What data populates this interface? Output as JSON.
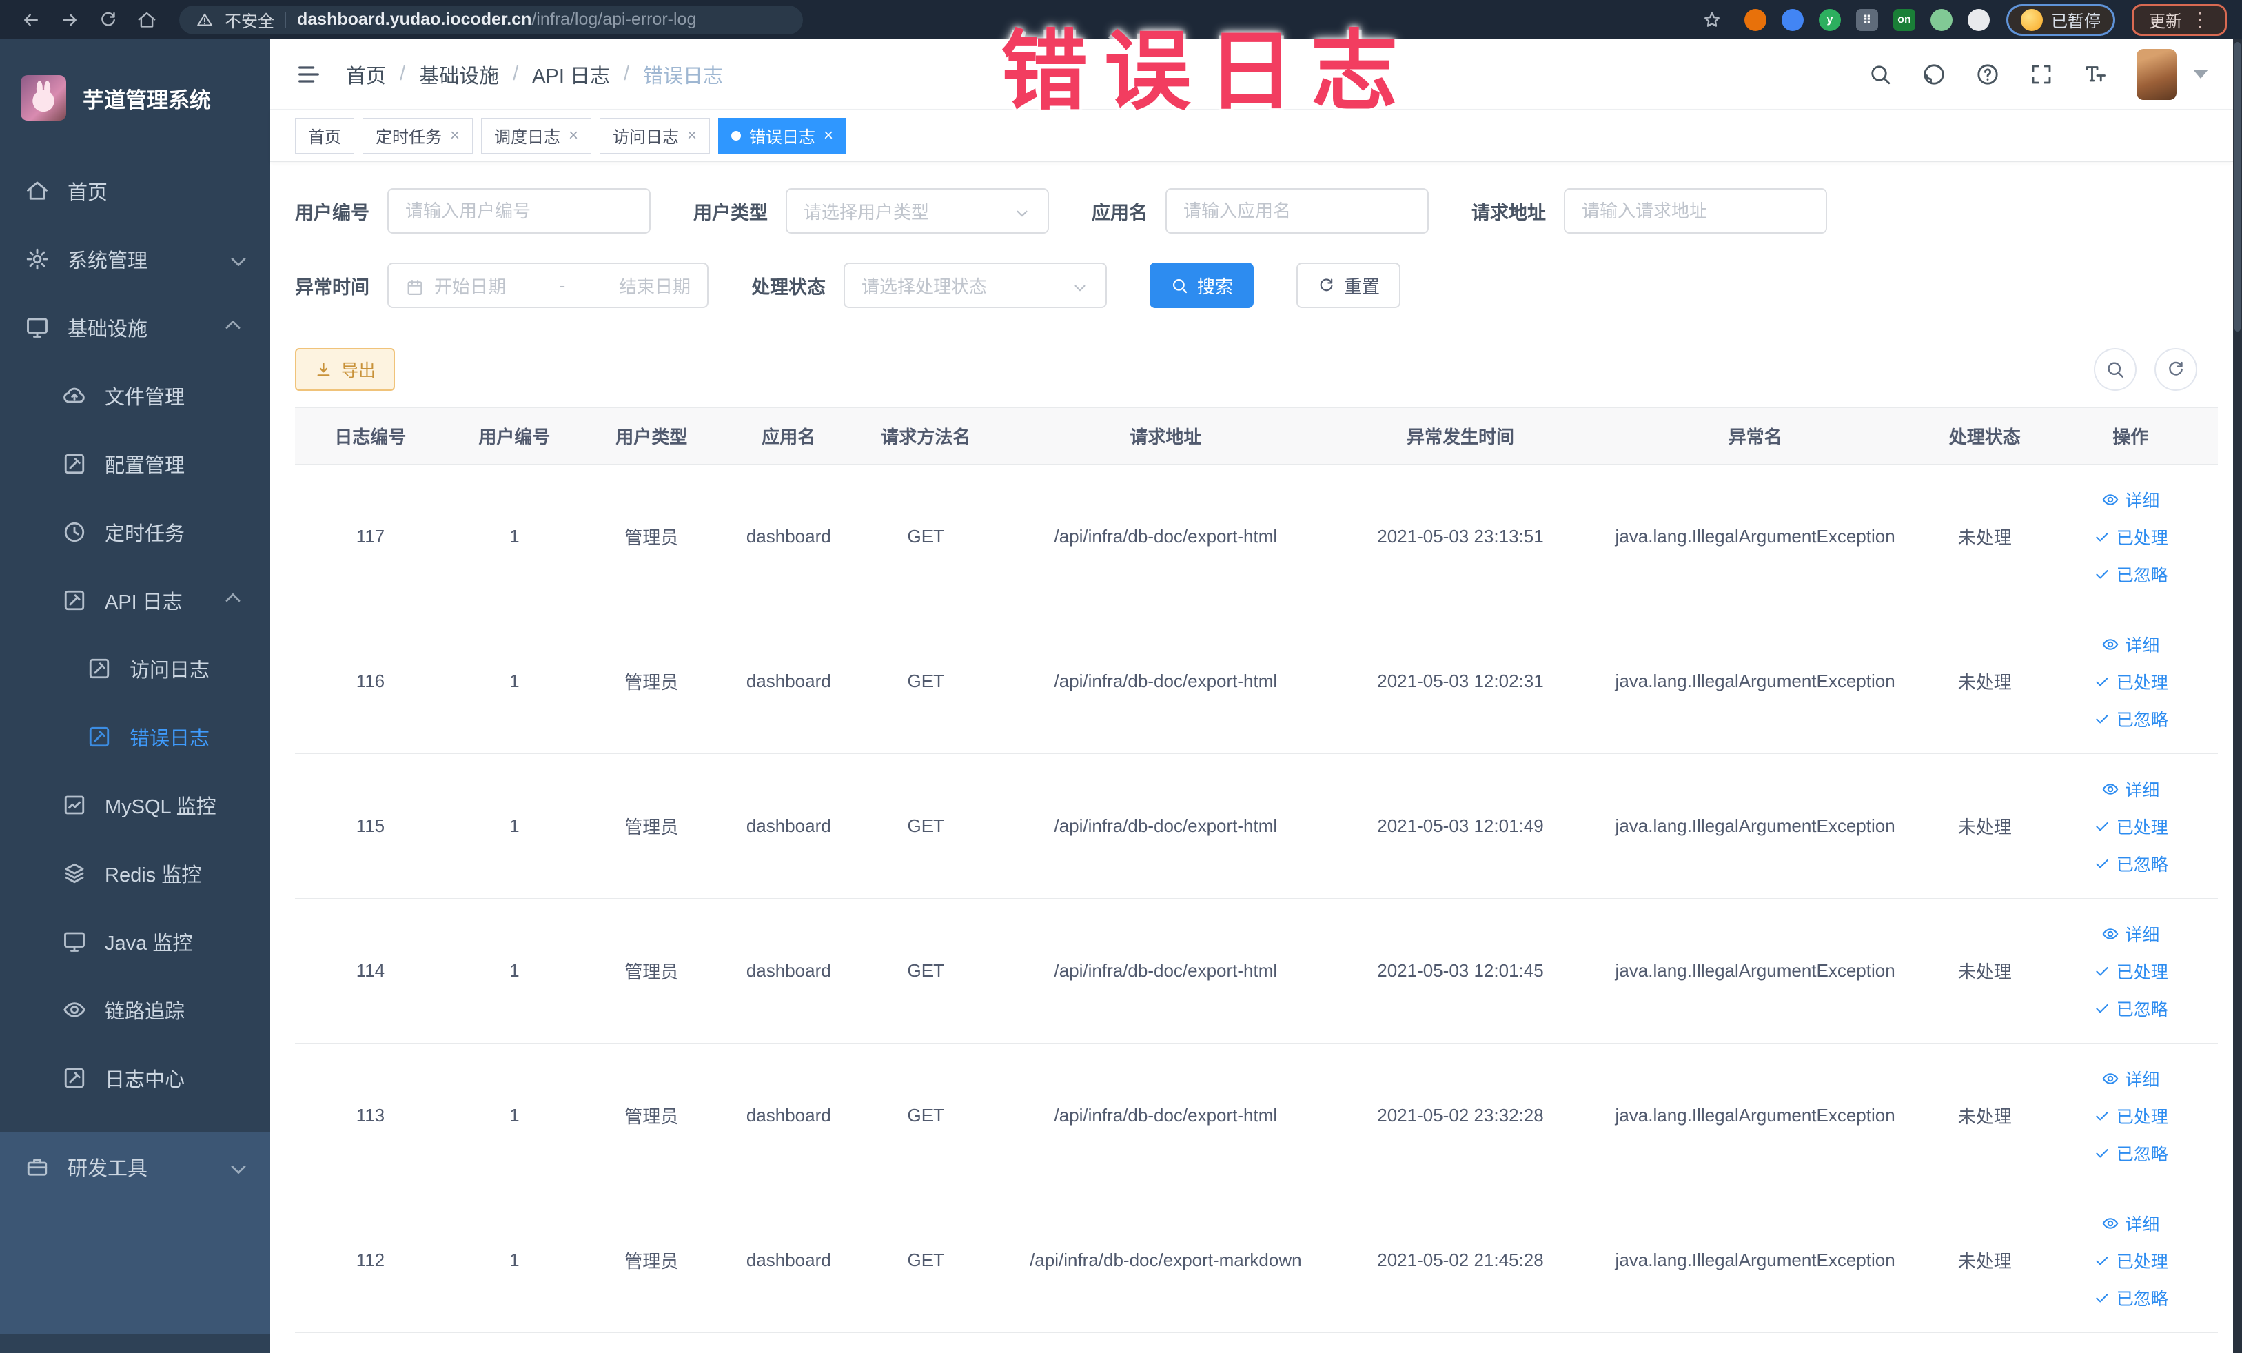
{
  "browser": {
    "security_label": "不安全",
    "url_host": "dashboard.yudao.iocoder.cn",
    "url_path": "/infra/log/api-error-log",
    "paused_badge": "已暂停",
    "update_badge": "更新",
    "extensions": [
      {
        "name": "ext-orange-circle",
        "color": "#e8710a",
        "shape": "circle"
      },
      {
        "name": "ext-blue-shield",
        "color": "#4285f4",
        "shape": "circle"
      },
      {
        "name": "ext-green-y",
        "color": "#2daf5f",
        "shape": "circle",
        "glyph": "y"
      },
      {
        "name": "ext-grid",
        "color": "#5f6b7a",
        "shape": "square",
        "glyph": "⠿"
      },
      {
        "name": "ext-on-toggle",
        "color": "#1a7f37",
        "shape": "square",
        "glyph": "on"
      },
      {
        "name": "ext-green-leaf",
        "color": "#81c995",
        "shape": "circle"
      },
      {
        "name": "ext-white-star",
        "color": "#e8eaed",
        "shape": "circle"
      }
    ]
  },
  "watermark": "错误日志",
  "sidebar": {
    "title": "芋道管理系统",
    "items": [
      {
        "icon": "home",
        "label": "首页",
        "level": 1
      },
      {
        "icon": "gear",
        "label": "系统管理",
        "level": 1,
        "chevron": "down"
      },
      {
        "icon": "monitor",
        "label": "基础设施",
        "level": 1,
        "chevron": "up"
      },
      {
        "icon": "cloud",
        "label": "文件管理",
        "level": 2
      },
      {
        "icon": "edit",
        "label": "配置管理",
        "level": 2
      },
      {
        "icon": "clock",
        "label": "定时任务",
        "level": 2
      },
      {
        "icon": "edit",
        "label": "API 日志",
        "level": 2,
        "chevron": "up"
      },
      {
        "icon": "edit",
        "label": "访问日志",
        "level": 3
      },
      {
        "icon": "edit",
        "label": "错误日志",
        "level": 3,
        "active": true
      },
      {
        "icon": "chart",
        "label": "MySQL 监控",
        "level": 2
      },
      {
        "icon": "layers",
        "label": "Redis 监控",
        "level": 2
      },
      {
        "icon": "monitor",
        "label": "Java 监控",
        "level": 2
      },
      {
        "icon": "eye",
        "label": "链路追踪",
        "level": 2
      },
      {
        "icon": "edit",
        "label": "日志中心",
        "level": 2
      }
    ],
    "bottom_item": {
      "icon": "tool",
      "label": "研发工具",
      "chevron": "down"
    }
  },
  "header": {
    "breadcrumb": [
      "首页",
      "基础设施",
      "API 日志",
      "错误日志"
    ]
  },
  "tabs": [
    {
      "label": "首页"
    },
    {
      "label": "定时任务",
      "closable": true
    },
    {
      "label": "调度日志",
      "closable": true
    },
    {
      "label": "访问日志",
      "closable": true
    },
    {
      "label": "错误日志",
      "closable": true,
      "active": true
    }
  ],
  "filters": {
    "user_id": {
      "label": "用户编号",
      "placeholder": "请输入用户编号"
    },
    "user_type": {
      "label": "用户类型",
      "placeholder": "请选择用户类型"
    },
    "app_name": {
      "label": "应用名",
      "placeholder": "请输入应用名"
    },
    "request_url": {
      "label": "请求地址",
      "placeholder": "请输入请求地址"
    },
    "exception_time": {
      "label": "异常时间",
      "start_placeholder": "开始日期",
      "separator": "-",
      "end_placeholder": "结束日期"
    },
    "process_status": {
      "label": "处理状态",
      "placeholder": "请选择处理状态"
    },
    "search_label": "搜索",
    "reset_label": "重置"
  },
  "toolbar": {
    "export_label": "导出"
  },
  "table": {
    "columns": [
      "日志编号",
      "用户编号",
      "用户类型",
      "应用名",
      "请求方法名",
      "请求地址",
      "异常发生时间",
      "异常名",
      "处理状态",
      "操作"
    ],
    "actions": [
      {
        "label": "详细",
        "icon": "eye"
      },
      {
        "label": "已处理",
        "icon": "check"
      },
      {
        "label": "已忽略",
        "icon": "check"
      }
    ],
    "rows": [
      {
        "id": "117",
        "user_id": "1",
        "user_type": "管理员",
        "app": "dashboard",
        "method": "GET",
        "url": "/api/infra/db-doc/export-html",
        "time": "2021-05-03 23:13:51",
        "exception": "java.lang.IllegalArgumentException",
        "status": "未处理"
      },
      {
        "id": "116",
        "user_id": "1",
        "user_type": "管理员",
        "app": "dashboard",
        "method": "GET",
        "url": "/api/infra/db-doc/export-html",
        "time": "2021-05-03 12:02:31",
        "exception": "java.lang.IllegalArgumentException",
        "status": "未处理"
      },
      {
        "id": "115",
        "user_id": "1",
        "user_type": "管理员",
        "app": "dashboard",
        "method": "GET",
        "url": "/api/infra/db-doc/export-html",
        "time": "2021-05-03 12:01:49",
        "exception": "java.lang.IllegalArgumentException",
        "status": "未处理"
      },
      {
        "id": "114",
        "user_id": "1",
        "user_type": "管理员",
        "app": "dashboard",
        "method": "GET",
        "url": "/api/infra/db-doc/export-html",
        "time": "2021-05-03 12:01:45",
        "exception": "java.lang.IllegalArgumentException",
        "status": "未处理"
      },
      {
        "id": "113",
        "user_id": "1",
        "user_type": "管理员",
        "app": "dashboard",
        "method": "GET",
        "url": "/api/infra/db-doc/export-html",
        "time": "2021-05-02 23:32:28",
        "exception": "java.lang.IllegalArgumentException",
        "status": "未处理"
      },
      {
        "id": "112",
        "user_id": "1",
        "user_type": "管理员",
        "app": "dashboard",
        "method": "GET",
        "url": "/api/infra/db-doc/export-markdown",
        "time": "2021-05-02 21:45:28",
        "exception": "java.lang.IllegalArgumentException",
        "status": "未处理"
      }
    ]
  },
  "colors": {
    "primary": "#2f97ff",
    "link": "#2d8cf0",
    "warning_border": "#f0c37a",
    "sidebar_bg": "#2e4156",
    "chrome_bg": "#1d2837",
    "watermark": "#f23d60"
  }
}
